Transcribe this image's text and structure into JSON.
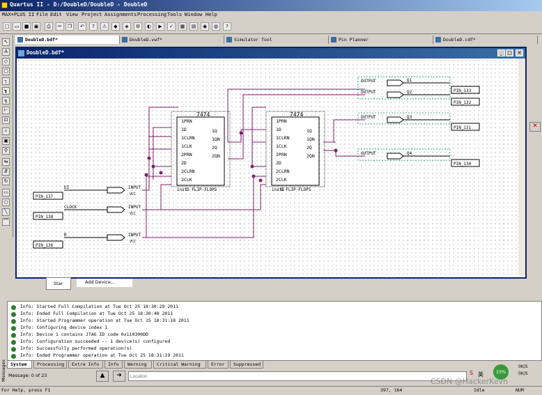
{
  "app": {
    "title": "Quartus II - D:/DoubleD/DoubleD - DoubleD",
    "menus": [
      "MAX+PLUS II",
      "File",
      "Edit",
      "View",
      "Project",
      "Assignments",
      "Processing",
      "Tools",
      "Window",
      "Help"
    ]
  },
  "doc_tabs": [
    {
      "label": "DoubleD.bdf*",
      "active": true
    },
    {
      "label": "DoubleD.vwf*",
      "active": false
    },
    {
      "label": "Simulator Tool",
      "active": false
    },
    {
      "label": "Pin Planner",
      "active": false
    },
    {
      "label": "DoubleD.cdf*",
      "active": false
    }
  ],
  "bdf_window": {
    "title": "DoubleD.bdf*"
  },
  "schematic": {
    "chip_type": "7474",
    "chip_caption": "D FLIP-FLOPS",
    "inst_left": "inst",
    "inst_right": "inst1",
    "pins": [
      "1PRN",
      "1D",
      "1CLRN",
      "1CLK",
      "2PRN",
      "2D",
      "2CLRN",
      "2CLK"
    ],
    "outputs": [
      "1Q",
      "1QN",
      "2Q",
      "2QN"
    ],
    "inputs": [
      {
        "signal": "DI",
        "pin": "PIN_137",
        "type": "INPUT",
        "vcc": "VCC"
      },
      {
        "signal": "CLOCK",
        "pin": "PIN_138",
        "type": "INPUT",
        "vcc": "VCC"
      },
      {
        "signal": "R",
        "pin": "PIN_136",
        "type": "INPUT",
        "vcc": "VCC"
      }
    ],
    "outputs_ports": [
      {
        "name": "Q1",
        "pin": "PIN_133",
        "type": "OUTPUT"
      },
      {
        "name": "Q2",
        "pin": "PIN_132",
        "type": "OUTPUT"
      },
      {
        "name": "Q3",
        "pin": "PIN_131",
        "type": "OUTPUT"
      },
      {
        "name": "Q4",
        "pin": "PIN_130",
        "type": "OUTPUT"
      }
    ]
  },
  "behind_panel": {
    "start_label": "Star",
    "add_device": "Add Device..."
  },
  "messages": [
    "Info: Started Full Compilation at Tue Oct 25 18:30:29 2011",
    "Info: Ended Full Compilation at Tue Oct 25 18:30:40 2011",
    "Info: Started Programmer operation at Tue Oct 25 18:31:18 2011",
    "Info: Configuring device index 1",
    "Info: Device 1 contains JTAG ID code 0x110300DD",
    "Info: Configuration succeeded -- 1 device(s) configured",
    "Info: Successfully performed operation(s)",
    "Info: Ended Programmer operation at Tue Oct 25 18:31:19 2011"
  ],
  "message_tabs": [
    "System",
    "Processing",
    "Extra Info",
    "Info",
    "Warning",
    "Critical Warning",
    "Error",
    "Suppressed"
  ],
  "message_bar": {
    "count": "Message: 0 of 23",
    "location_placeholder": "Location",
    "side_label": "Messages"
  },
  "status": {
    "help": "For Help, press F1",
    "coords": "397, 164",
    "state": "Idle",
    "num": "NUM"
  },
  "tray": {
    "ime": "英",
    "percent": "33%",
    "rate1": "0K/S",
    "rate2": "0K/S"
  },
  "watermark": "CSDN @HackerKevn",
  "colors": {
    "wire": "#7b1f6a",
    "title_blue": "#0a246a",
    "msg_green": "#2d7f2d"
  }
}
